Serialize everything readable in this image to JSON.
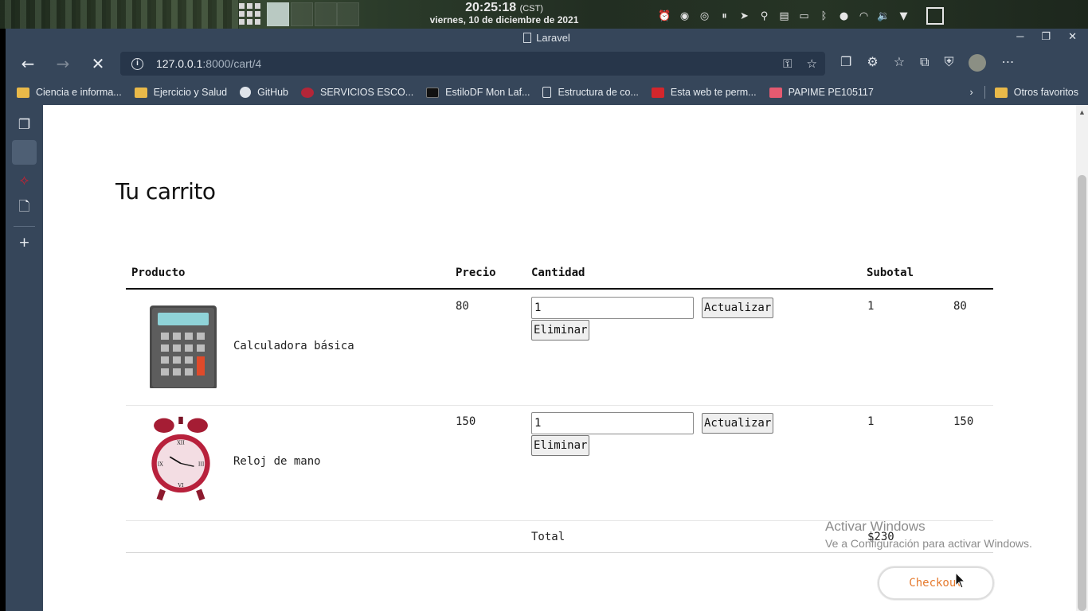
{
  "os_panel": {
    "time": "20:25:18",
    "tz": "(CST)",
    "date": "viernes, 10 de diciembre de 2021",
    "tray_icons": [
      "alarm-icon",
      "record-icon",
      "headset-icon",
      "pause-icon",
      "telegram-icon",
      "location-icon",
      "clipboard-icon",
      "battery-icon",
      "bluetooth-icon",
      "mic-icon",
      "wifi-icon",
      "volume-icon",
      "menu-down-icon",
      "window-icon"
    ]
  },
  "browser": {
    "window_title": "Laravel",
    "url_host": "127.0.0.1",
    "url_rest": ":8000/cart/4",
    "bookmarks": [
      {
        "label": "Ciencia e informa...",
        "icon": "folder-icon"
      },
      {
        "label": "Ejercicio y Salud",
        "icon": "folder-icon"
      },
      {
        "label": "GitHub",
        "icon": "github-icon"
      },
      {
        "label": "SERVICIOS ESCO...",
        "icon": "heart-icon"
      },
      {
        "label": "EstiloDF Mon Laf...",
        "icon": "estilodf-icon"
      },
      {
        "label": "Estructura de co...",
        "icon": "page-icon"
      },
      {
        "label": "Esta web te perm...",
        "icon": "red-site-icon"
      },
      {
        "label": "PAPIME PE105117",
        "icon": "pink-site-icon"
      }
    ],
    "other_favorites": "Otros favoritos"
  },
  "page": {
    "title": "Tu carrito",
    "headers": {
      "product": "Producto",
      "price": "Precio",
      "quantity": "Cantidad",
      "subtotal": "Subotal"
    },
    "items": [
      {
        "name": "Calculadora básica",
        "price": "80",
        "qty": "1",
        "subtotal_qty": "1",
        "subtotal": "80",
        "image": "calculator-image"
      },
      {
        "name": "Reloj de mano",
        "price": "150",
        "qty": "1",
        "subtotal_qty": "1",
        "subtotal": "150",
        "image": "alarm-clock-image"
      }
    ],
    "update_label": "Actualizar",
    "remove_label": "Eliminar",
    "total_label": "Total",
    "total_value": "$230",
    "checkout_label": "Checkout"
  },
  "watermark": {
    "line1": "Activar Windows",
    "line2": "Ve a Configuración para activar Windows."
  },
  "colors": {
    "chrome": "#36465a",
    "urlbar": "#27364a",
    "checkout_text": "#e57a2e"
  }
}
